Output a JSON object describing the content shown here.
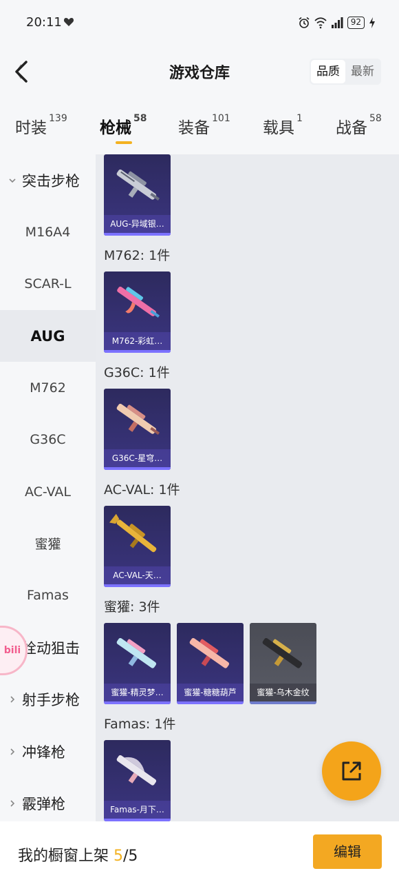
{
  "status_bar": {
    "time": "20:11",
    "battery": "92"
  },
  "header": {
    "title": "游戏仓库",
    "sort_options": [
      {
        "label": "品质",
        "active": true
      },
      {
        "label": "最新",
        "active": false
      }
    ]
  },
  "tabs": [
    {
      "label": "时装",
      "count": "139"
    },
    {
      "label": "枪械",
      "count": "58",
      "active": true
    },
    {
      "label": "装备",
      "count": "101"
    },
    {
      "label": "载具",
      "count": "1"
    },
    {
      "label": "战备",
      "count": "58"
    }
  ],
  "subnav": [
    {
      "label": "突击步枪",
      "type": "group",
      "expanded": true
    },
    {
      "label": "M16A4"
    },
    {
      "label": "SCAR-L"
    },
    {
      "label": "AUG",
      "active": true
    },
    {
      "label": "M762"
    },
    {
      "label": "G36C"
    },
    {
      "label": "AC-VAL"
    },
    {
      "label": "蜜獾"
    },
    {
      "label": "Famas"
    },
    {
      "label": "栓动狙击",
      "type": "group"
    },
    {
      "label": "射手步枪",
      "type": "group"
    },
    {
      "label": "冲锋枪",
      "type": "group"
    },
    {
      "label": "霰弹枪",
      "type": "group"
    }
  ],
  "sections": [
    {
      "label": "",
      "items": [
        {
          "name": "AUG-异域银…"
        }
      ]
    },
    {
      "label": "M762: 1件",
      "items": [
        {
          "name": "M762-彩虹…"
        }
      ]
    },
    {
      "label": "G36C: 1件",
      "items": [
        {
          "name": "G36C-星穹…"
        }
      ]
    },
    {
      "label": "AC-VAL: 1件",
      "items": [
        {
          "name": "AC-VAL-天…"
        }
      ]
    },
    {
      "label": "蜜獾: 3件",
      "items": [
        {
          "name": "蜜獾-精灵梦…"
        },
        {
          "name": "蜜獾-糖糖葫芦"
        },
        {
          "name": "蜜獾-乌木金纹"
        }
      ]
    },
    {
      "label": "Famas: 1件",
      "items": [
        {
          "name": "Famas-月下…"
        }
      ]
    }
  ],
  "bili_badge": "bili",
  "bottom_bar": {
    "showcase_label": "我的橱窗上架 ",
    "showcase_current": "5",
    "showcase_total": "/5",
    "edit_label": "编辑"
  },
  "colors": {
    "accent": "#f3a822",
    "card_bg": "#2d2a5e",
    "card_stripe": "#7c72ff"
  }
}
